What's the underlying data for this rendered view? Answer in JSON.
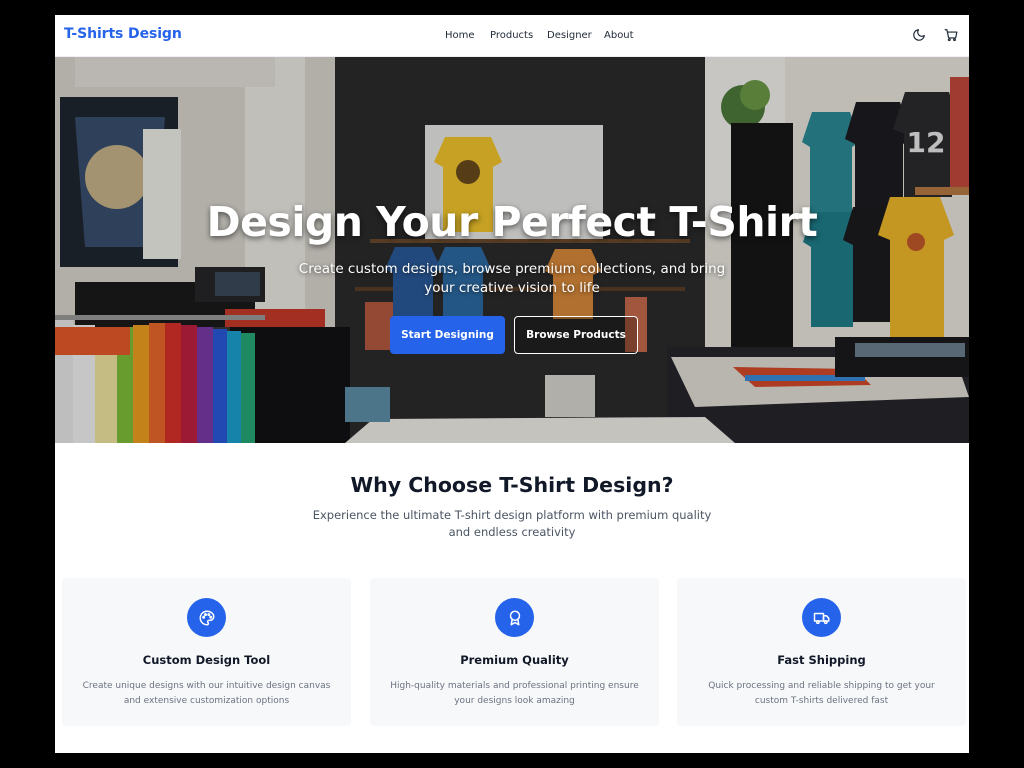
{
  "brand": {
    "name": "T-Shirts Design",
    "color": "#2563eb"
  },
  "nav": {
    "links": [
      {
        "label": "Home"
      },
      {
        "label": "Products"
      },
      {
        "label": "Designer"
      },
      {
        "label": "About"
      }
    ],
    "icons": [
      "moon-icon",
      "cart-icon"
    ]
  },
  "hero": {
    "title": "Design Your Perfect T-Shirt",
    "subtitle": "Create custom designs, browse premium collections, and bring your creative vision to life",
    "primary_button": "Start Designing",
    "secondary_button": "Browse Products"
  },
  "why": {
    "title": "Why Choose T-Shirt Design?",
    "subtitle": "Experience the ultimate T-shirt design platform with premium quality and endless creativity",
    "features": [
      {
        "icon": "palette-icon",
        "title": "Custom Design Tool",
        "description": "Create unique designs with our intuitive design canvas and extensive customization options"
      },
      {
        "icon": "award-icon",
        "title": "Premium Quality",
        "description": "High-quality materials and professional printing ensure your designs look amazing"
      },
      {
        "icon": "truck-icon",
        "title": "Fast Shipping",
        "description": "Quick processing and reliable shipping to get your custom T-shirts delivered fast"
      }
    ]
  },
  "colors": {
    "accent": "#2563eb",
    "heading": "#111827",
    "body_text": "#4b5563",
    "card_bg": "#f7f8fa"
  }
}
